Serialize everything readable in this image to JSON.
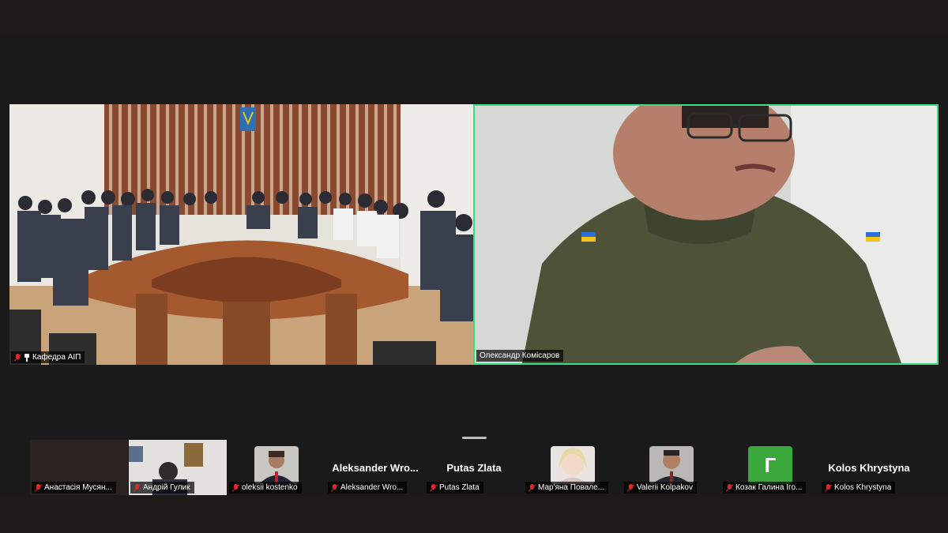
{
  "main_tiles": [
    {
      "name": "Кафедра АІП",
      "pinned": true,
      "muted": true
    },
    {
      "name": "Олександр Комісаров",
      "active_speaker": true,
      "muted": false
    }
  ],
  "thumbnails": [
    {
      "name": "Анастасія Мусян...",
      "muted": true,
      "video": "off"
    },
    {
      "name": "Андрій Гулик",
      "muted": true,
      "video": "on"
    },
    {
      "name": "oleksii kostenko",
      "muted": true,
      "video": "photo"
    },
    {
      "name": "Aleksander Wro...",
      "display_name": "Aleksander  Wro...",
      "muted": true,
      "video": "off"
    },
    {
      "name": "Putas Zlata",
      "display_name": "Putas Zlata",
      "muted": true,
      "video": "off"
    },
    {
      "name": "Мар'яна Повале...",
      "muted": true,
      "video": "photo"
    },
    {
      "name": "Valerii Kolpakov",
      "muted": true,
      "video": "photo"
    },
    {
      "name": "Козак Галина Іго...",
      "avatar_letter": "Г",
      "muted": true,
      "video": "letter"
    },
    {
      "name": "Kolos Khrystyna",
      "display_name": "Kolos Khrystyna",
      "muted": true,
      "video": "off"
    }
  ],
  "colors": {
    "active_speaker_border": "#3ddc84",
    "muted_icon": "#e02828",
    "letter_avatar": "#3aa83a",
    "background": "#1a1a1a"
  }
}
